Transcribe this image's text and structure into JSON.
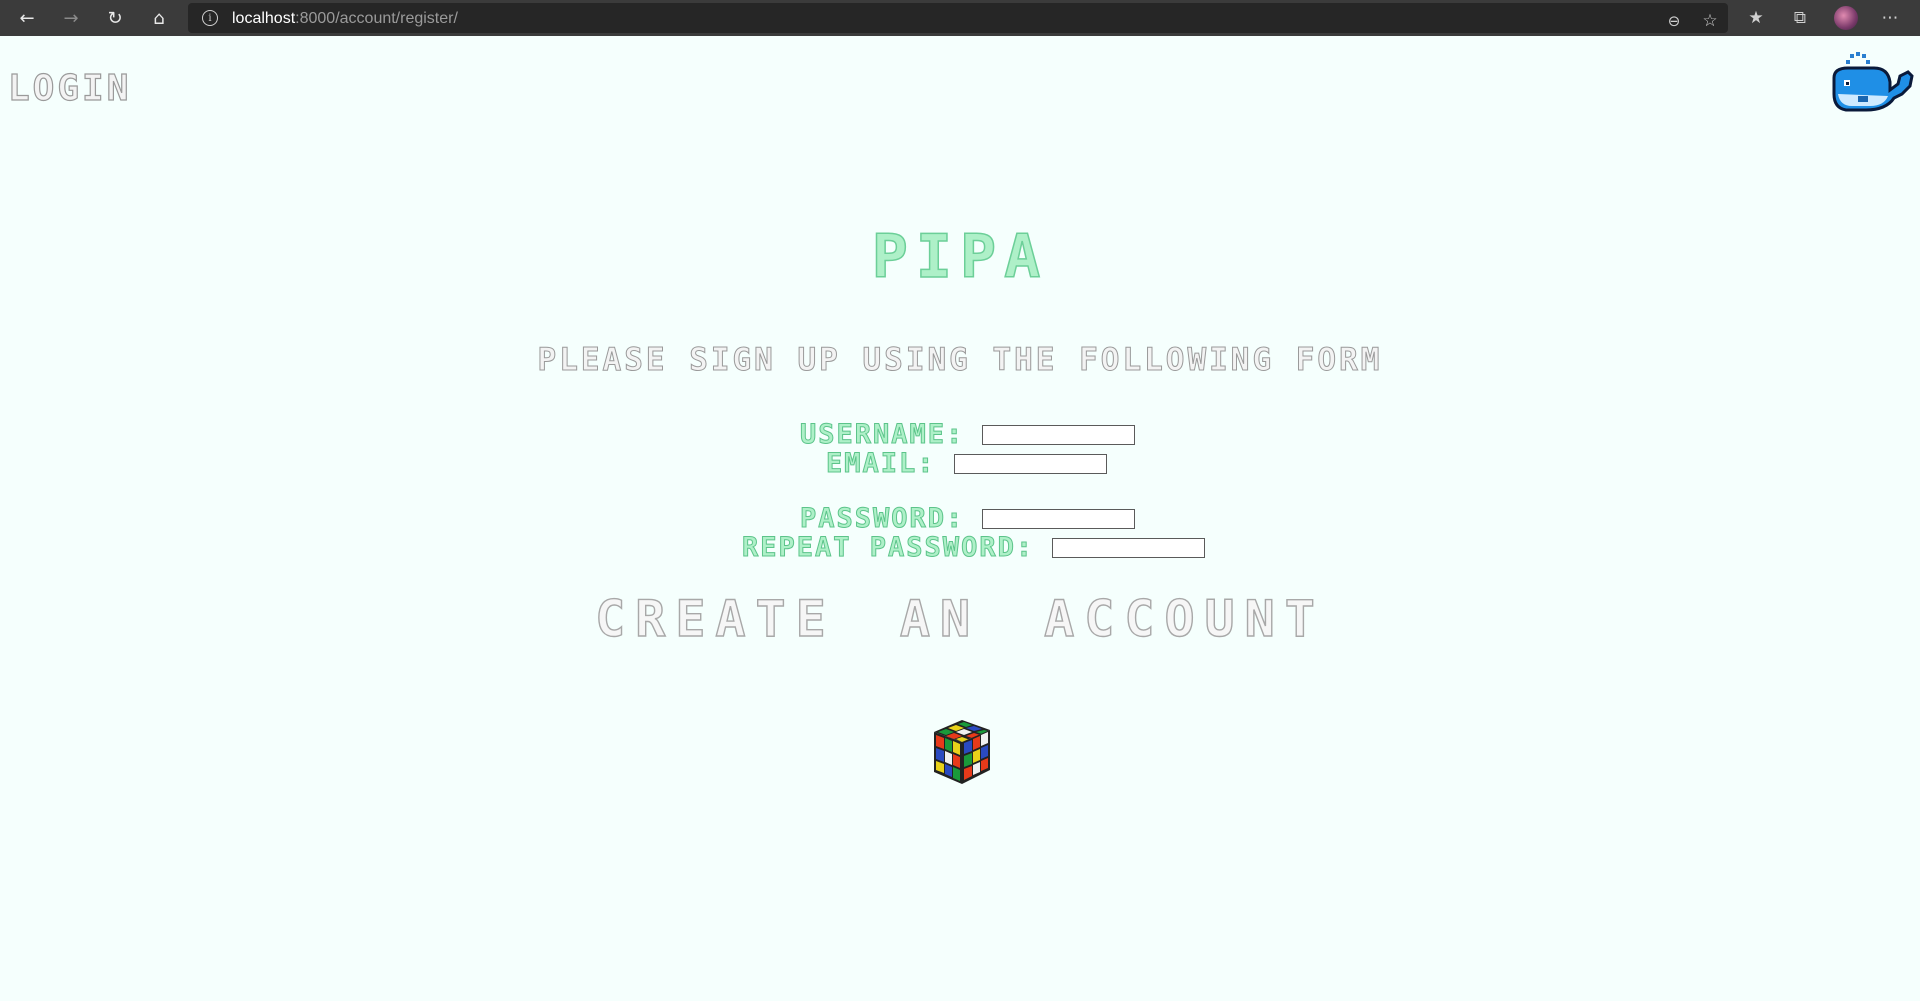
{
  "browser": {
    "url_host": "localhost",
    "url_rest": ":8000/account/register/"
  },
  "page": {
    "login_link": "LOGIN",
    "title": "PIPA",
    "subtitle": "PLEASE SIGN UP USING THE FOLLOWING FORM",
    "submit_label": "CREATE AN ACCOUNT"
  },
  "form": {
    "username_label": "USERNAME:",
    "email_label": "EMAIL:",
    "password_label": "PASSWORD:",
    "repeat_password_label": "REPEAT PASSWORD:",
    "username_value": "",
    "email_value": "",
    "password_value": "",
    "repeat_password_value": ""
  },
  "icons": {
    "back": "back-arrow-icon",
    "forward": "forward-arrow-icon",
    "reload": "reload-icon",
    "home": "home-icon",
    "info": "site-info-icon",
    "zoom": "zoom-out-icon",
    "favorite": "add-favorite-icon",
    "favorites": "favorites-icon",
    "collections": "collections-icon",
    "menu": "more-menu-icon",
    "whale": "whale-logo-icon",
    "cube": "rubiks-cube-icon"
  },
  "colors": {
    "page_background": "#f5fffd",
    "accent_green": "#aef0c8",
    "browser_bar": "#3b3b3b"
  }
}
